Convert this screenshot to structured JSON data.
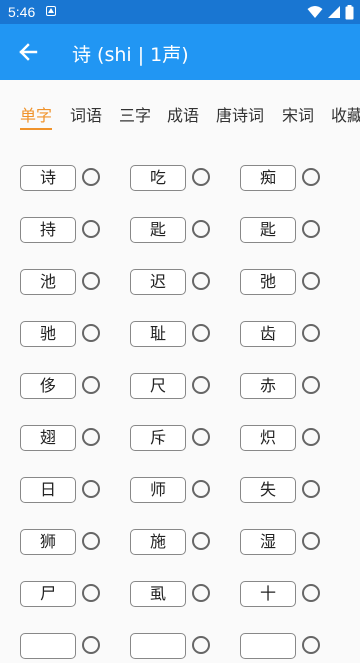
{
  "status": {
    "time": "5:46"
  },
  "appbar": {
    "title": "诗 (shi | 1声)"
  },
  "tabs": [
    {
      "label": "单字",
      "active": true
    },
    {
      "label": "词语",
      "active": false
    },
    {
      "label": "三字",
      "active": false
    },
    {
      "label": "成语",
      "active": false
    },
    {
      "label": "唐诗词",
      "active": false
    },
    {
      "label": "宋词",
      "active": false
    },
    {
      "label": "收藏",
      "active": false
    }
  ],
  "characters": [
    [
      "诗",
      "吃",
      "痴"
    ],
    [
      "持",
      "匙",
      "匙"
    ],
    [
      "池",
      "迟",
      "弛"
    ],
    [
      "驰",
      "耻",
      "齿"
    ],
    [
      "侈",
      "尺",
      "赤"
    ],
    [
      "翅",
      "斥",
      "炽"
    ],
    [
      "日",
      "师",
      "失"
    ],
    [
      "狮",
      "施",
      "湿"
    ],
    [
      "尸",
      "虱",
      "十"
    ]
  ],
  "colors": {
    "primary": "#2196f3",
    "statusbar": "#1976d2",
    "accent": "#f0932b"
  }
}
